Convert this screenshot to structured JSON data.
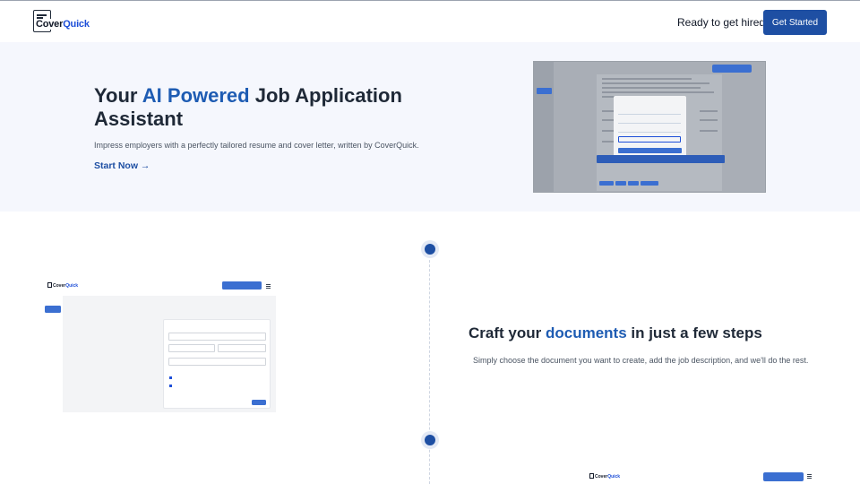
{
  "header": {
    "logo_text_a": "Cover",
    "logo_text_b": "Quick",
    "ready_text": "Ready to get hired?",
    "cta_label": "Get Started"
  },
  "hero": {
    "title_a": "Your ",
    "title_accent": "AI Powered",
    "title_b": " Job Application Assistant",
    "subtitle": "Impress employers with a perfectly tailored resume and cover letter, written by CoverQuick.",
    "link_label": "Start Now →"
  },
  "steps": {
    "title_a": "Craft your ",
    "title_accent": "documents",
    "title_b": " in just a few steps",
    "subtitle": "Simply choose the document you want to create, add the job description, and we'll do the rest."
  },
  "colors": {
    "accent": "#1e5cb3",
    "button": "#1e4fa3",
    "hero_bg": "#f5f7fd"
  },
  "icons": [
    "logo-icon",
    "arrow-right-icon",
    "menu-icon"
  ]
}
